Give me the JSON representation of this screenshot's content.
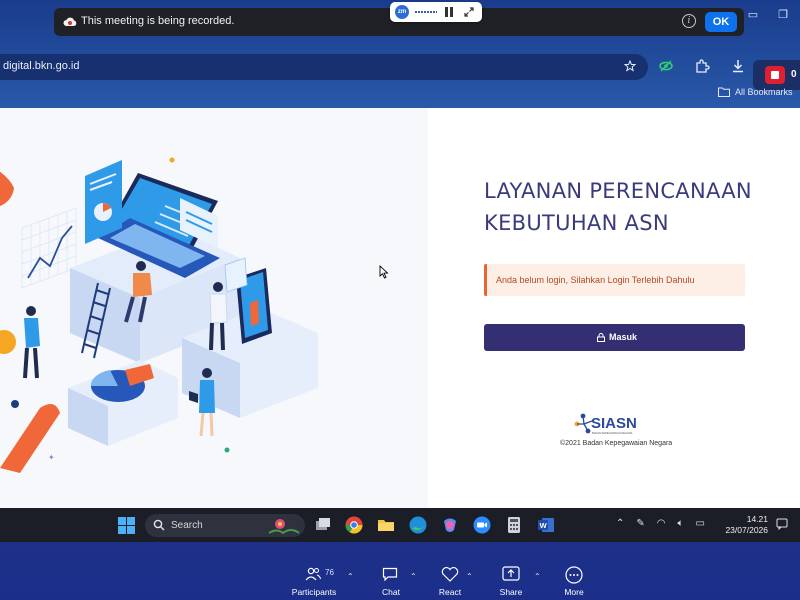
{
  "zoom_banner": {
    "message": "This meeting is being recorded.",
    "ok_label": "OK",
    "logo_text": "zm"
  },
  "browser": {
    "url": "digital.bkn.go.id",
    "bookmarks_label": "All Bookmarks",
    "extension_badge": "0"
  },
  "page": {
    "title_line1": "LAYANAN PERENCANAAN",
    "title_line2": "KEBUTUHAN ASN",
    "alert": "Anda belum login, Silahkan Login Terlebih Dahulu",
    "login_button": "Masuk",
    "logo_text": "SIASN",
    "logo_subtext": "BADAN KEPEGAWAIAN NEGARA",
    "copyright": "©2021 Badan Kepegawaian Negara"
  },
  "taskbar": {
    "search_label": "Search",
    "time": "14.21",
    "date": "23/07/2026"
  },
  "zoom_controls": {
    "participants_label": "Participants",
    "participants_count": "76",
    "chat_label": "Chat",
    "react_label": "React",
    "share_label": "Share",
    "more_label": "More"
  },
  "colors": {
    "title": "#3a3a7c",
    "button": "#332f72",
    "alert_bg": "#fdeee6",
    "alert_border": "#e8623a",
    "zoom_ok": "#0e72ed",
    "zoom_bar": "#1b2f8a"
  }
}
